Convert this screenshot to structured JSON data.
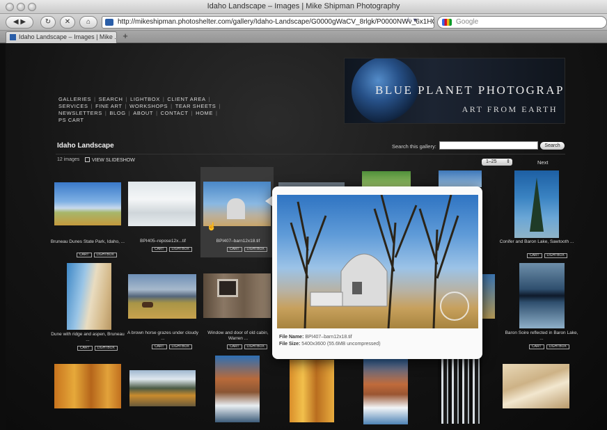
{
  "window": {
    "title": "Idaho Landscape – Images | Mike Shipman Photography"
  },
  "toolbar": {
    "url": "http://mikeshipman.photoshelter.com/gallery/Idaho-Landscape/G0000gWaCV_8rlgk/P0000NWv_6x1HQvs",
    "search_placeholder": "Google"
  },
  "tabs": [
    {
      "label": "Idaho Landscape – Images | Mike ..."
    }
  ],
  "site": {
    "nav": [
      "GALLERIES",
      "SEARCH",
      "LIGHTBOX",
      "CLIENT AREA",
      "SERVICES",
      "FINE ART",
      "WORKSHOPS",
      "TEAR SHEETS",
      "NEWSLETTERS",
      "BLOG",
      "ABOUT",
      "CONTACT",
      "HOME",
      "PS CART"
    ],
    "brand": "BLUE PLANET PHOTOGRAPHY",
    "tagline": "ART FROM EARTH"
  },
  "gallery": {
    "title": "Idaho Landscape",
    "search_label": "Search this gallery:",
    "search_button": "Search",
    "count": "12 images",
    "slideshow": "VIEW SLIDESHOW",
    "range": "1–25",
    "next": "Next",
    "cart_label": "CART",
    "lightbox_label": "LIGHTBOX",
    "captions": {
      "bruneau": "Bruneau Dunes State Park, Idaho, ...",
      "bpi405": "BPI405–repose12x...tif",
      "barn": "BPI407–barn12x18.tif",
      "conifer": "Conifer and Baron Lake, Sawtooth ...",
      "dune": "Dune with ridge and aspen, Bruneau ...",
      "horse": "A brown horse grazes under cloudy ...",
      "window": "Window and door of old cabin, Warren ...",
      "baron": "Baron Soire reflected in Baron Lake, ..."
    }
  },
  "popup": {
    "file_name_label": "File Name:",
    "file_name": "BPI407–barn12x18.tif",
    "file_size_label": "File Size:",
    "file_size": "5400x3600 (55.6MB uncompressed)"
  }
}
